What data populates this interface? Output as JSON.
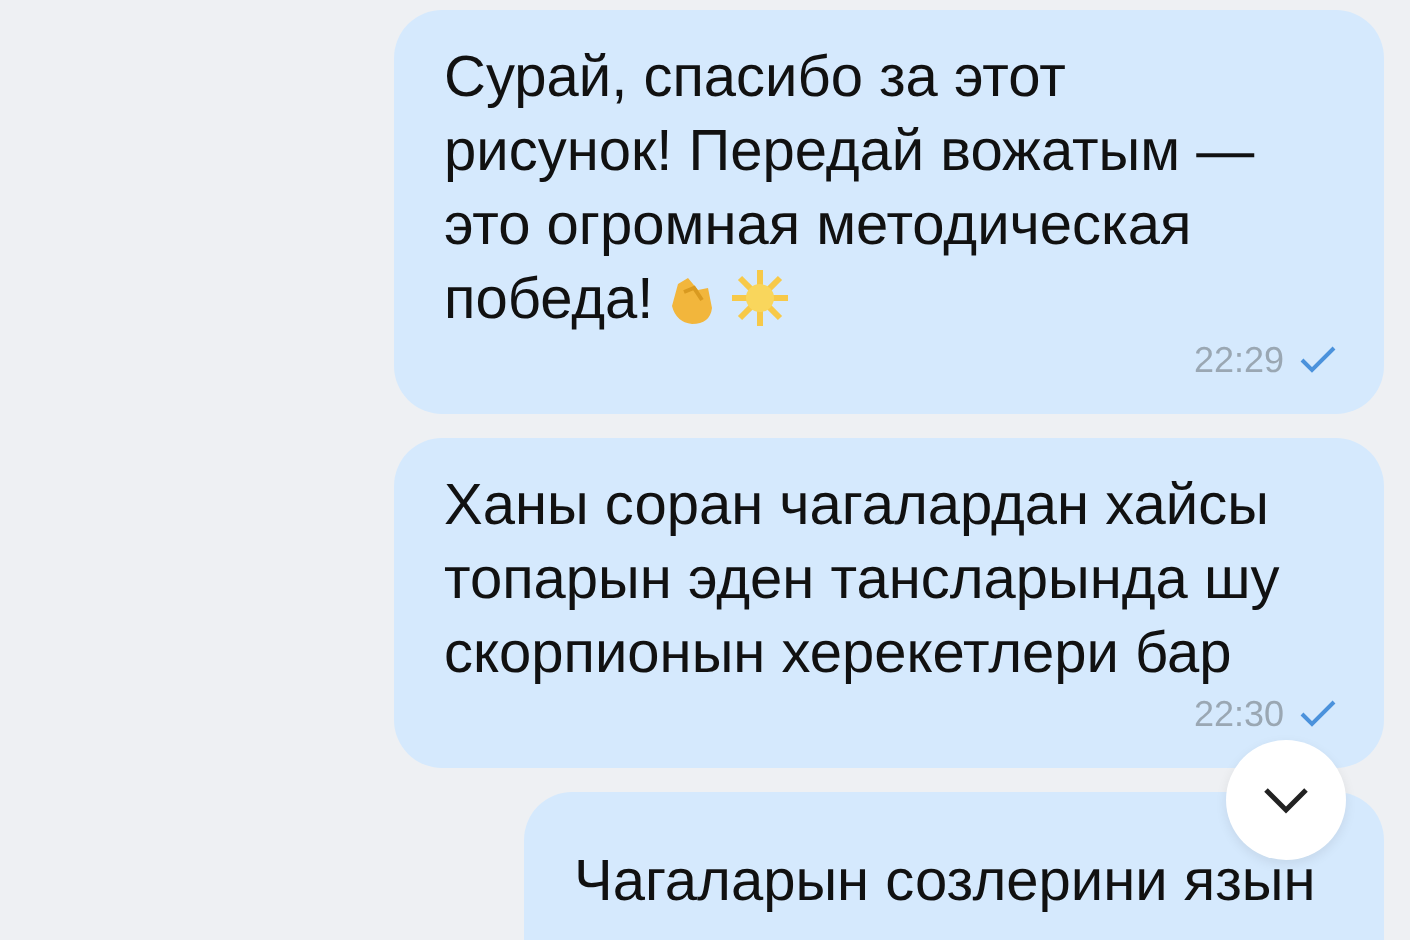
{
  "messages": [
    {
      "text": "Сурай, спасибо за этот\nрисунок! Передай вожатым —\nэто огромная методическая\nпобеда!",
      "emoji": true,
      "time": "22:29",
      "read": true
    },
    {
      "text": "Ханы соран чагалардан хайсы\nтопарын эден тансларында шу\nскорпионын херекетлери бар",
      "emoji": false,
      "time": "22:30",
      "read": true
    },
    {
      "text": "Чагаларын созлерини язын",
      "emoji": false
    }
  ]
}
